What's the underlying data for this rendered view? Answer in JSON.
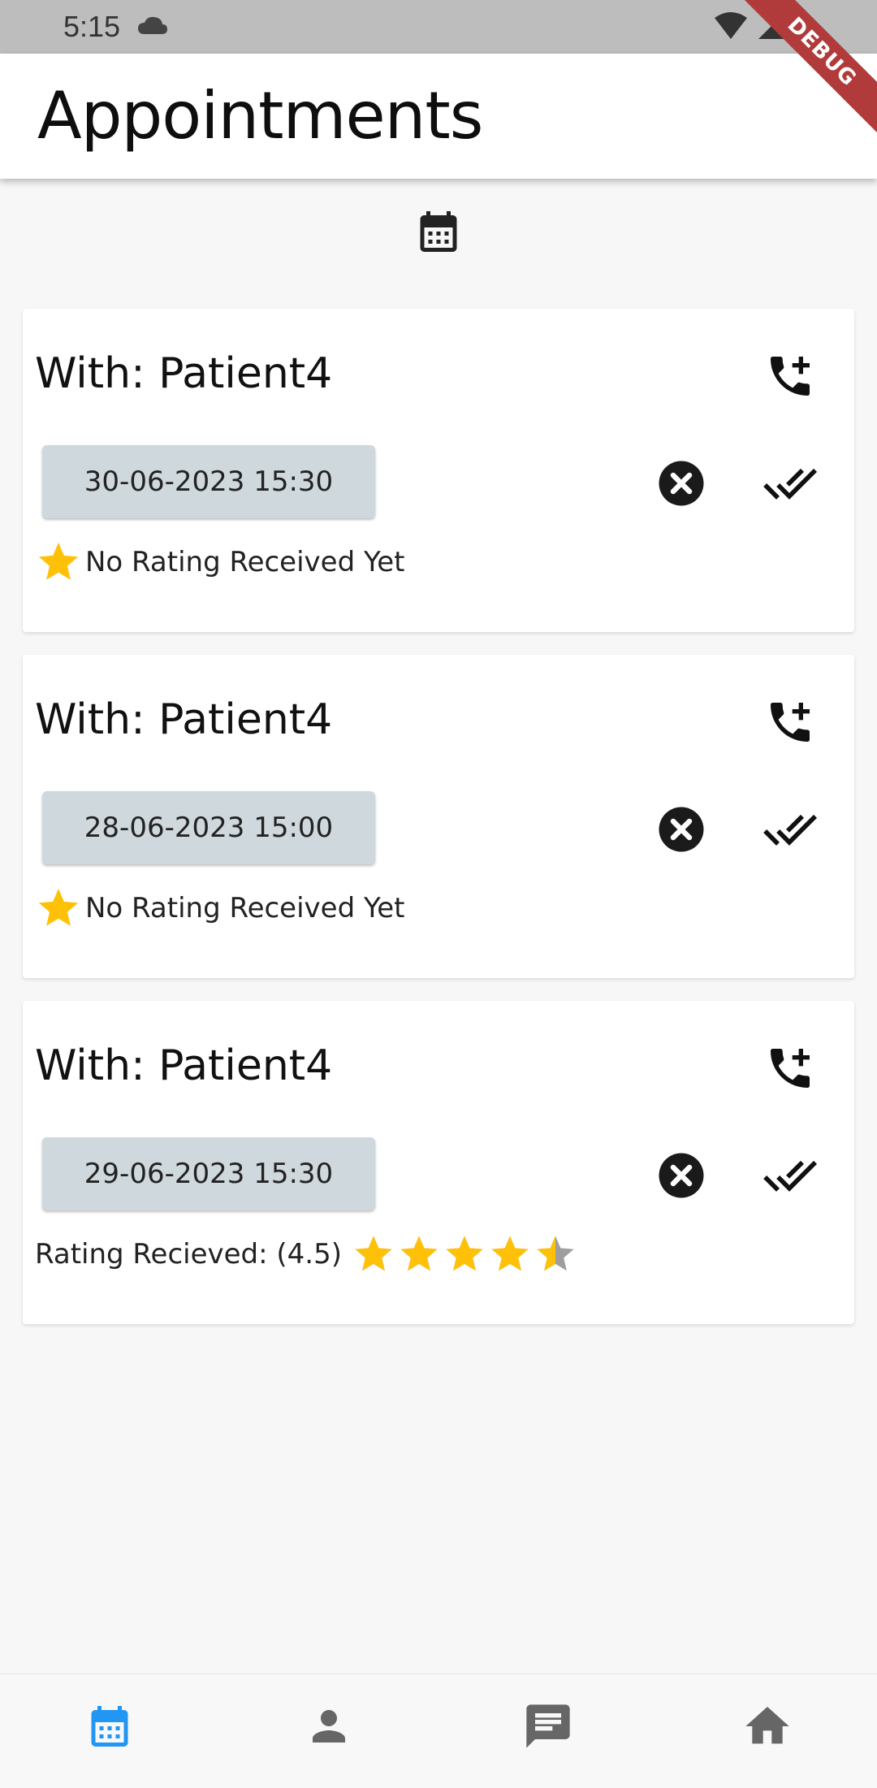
{
  "status_bar": {
    "time": "5:15"
  },
  "debug_banner": "DEBUG",
  "app_bar": {
    "title": "Appointments"
  },
  "colors": {
    "accent": "#2196f3",
    "star": "#ffc107",
    "chip": "#cfd8dc",
    "star_empty": "#9e9e9e"
  },
  "appointments": [
    {
      "with": "With: Patient4",
      "datetime": "30-06-2023 15:30",
      "rating_text": "No Rating Received Yet",
      "rating": null
    },
    {
      "with": "With: Patient4",
      "datetime": "28-06-2023 15:00",
      "rating_text": "No Rating Received Yet",
      "rating": null
    },
    {
      "with": "With: Patient4",
      "datetime": "29-06-2023 15:30",
      "rating_text": "Rating Recieved: (4.5)",
      "rating": 4.5
    }
  ],
  "bottom_nav": [
    {
      "icon": "calendar-icon",
      "active": true
    },
    {
      "icon": "person-icon",
      "active": false
    },
    {
      "icon": "chat-icon",
      "active": false
    },
    {
      "icon": "home-icon",
      "active": false
    }
  ]
}
